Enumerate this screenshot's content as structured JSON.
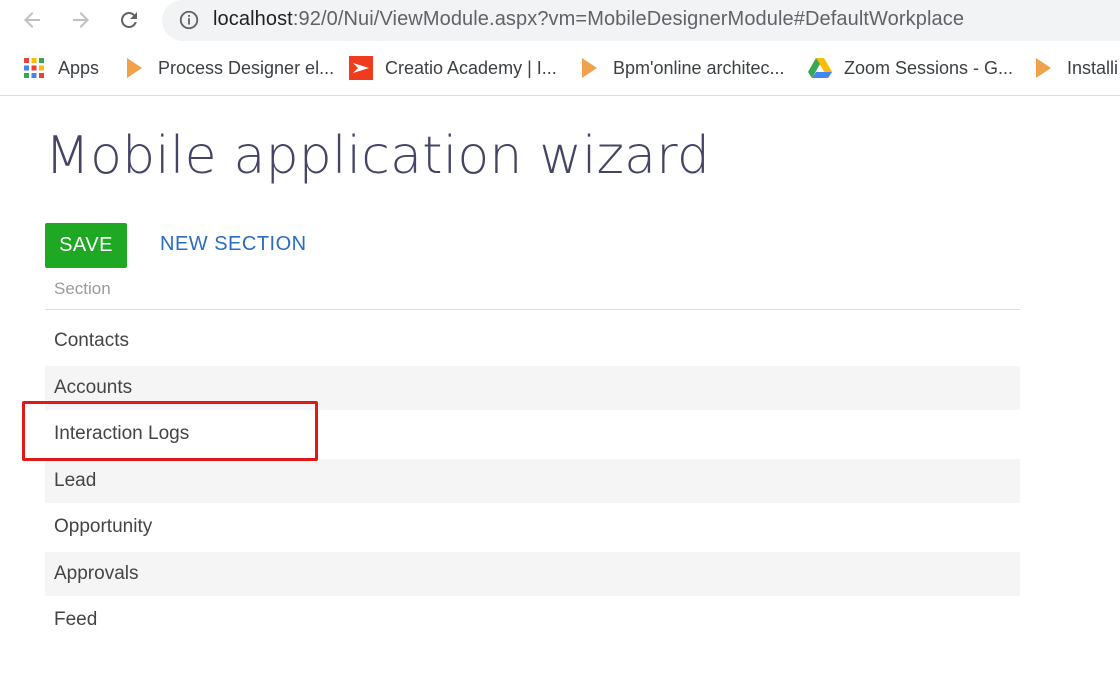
{
  "browser": {
    "url_host": "localhost",
    "url_rest": ":92/0/Nui/ViewModule.aspx?vm=MobileDesignerModule#DefaultWorkplace",
    "bookmarks": [
      {
        "label": "Apps",
        "icon": "apps-grid-icon"
      },
      {
        "label": "Process Designer el...",
        "icon": "bookmark-play-icon"
      },
      {
        "label": "Creatio Academy | I...",
        "icon": "creatio-logo-icon"
      },
      {
        "label": "Bpm'online architec...",
        "icon": "bookmark-play-icon"
      },
      {
        "label": "Zoom Sessions - G...",
        "icon": "google-drive-icon"
      },
      {
        "label": "Installi",
        "icon": "bookmark-play-icon"
      }
    ]
  },
  "page": {
    "title": "Mobile application wizard",
    "save_label": "SAVE",
    "new_section_label": "NEW SECTION",
    "column_header": "Section",
    "sections": [
      "Contacts",
      "Accounts",
      "Interaction Logs",
      "Lead",
      "Opportunity",
      "Approvals",
      "Feed"
    ]
  },
  "colors": {
    "save_button": "#1fa823",
    "link": "#2a6dc0",
    "highlight": "#e01818",
    "title": "#444466"
  }
}
